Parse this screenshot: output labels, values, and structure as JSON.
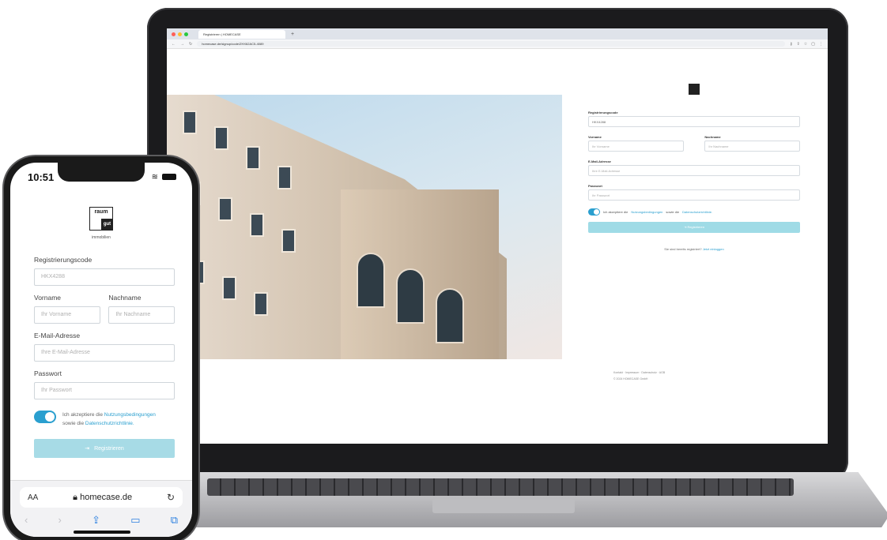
{
  "laptop": {
    "browser": {
      "tab_title": "Registrieren | HOMECASE",
      "url": "homecase.de/signup/code/ZHX62AC5-4089",
      "icons": [
        "back-icon",
        "forward-icon",
        "reload-icon",
        "lock-icon",
        "key-icon",
        "share-icon",
        "star-icon",
        "tabs-icon",
        "menu-icon"
      ]
    },
    "form": {
      "code_label": "Registrierungscode",
      "code_value": "HKX4288",
      "firstname_label": "Vorname",
      "firstname_placeholder": "Ihr Vorname",
      "lastname_label": "Nachname",
      "lastname_placeholder": "Ihr Nachname",
      "email_label": "E-Mail-Adresse",
      "email_placeholder": "Ihre E-Mail-Adresse",
      "password_label": "Passwort",
      "password_placeholder": "Ihr Passwort",
      "terms_prefix": "Ich akzeptiere die",
      "terms_link": "Nutzungsbedingungen",
      "terms_mid": "sowie die",
      "privacy_link": "Datenschutzrichtlinie.",
      "submit_label": "Registrieren",
      "login_text": "Sie sind bereits registriert?",
      "login_link": "Jetzt einloggen"
    },
    "footer": {
      "links": "Kontakt · Impressum · Datenschutz · AGB",
      "copyright": "© 2024 HOMECASE GmbH"
    }
  },
  "phone": {
    "status_time": "10:51",
    "logo": {
      "word1": "raum",
      "word2": "gut",
      "sub": "immobilien"
    },
    "form": {
      "code_label": "Registrierungscode",
      "code_value": "HKX4288",
      "firstname_label": "Vorname",
      "firstname_placeholder": "Ihr Vorname",
      "lastname_label": "Nachname",
      "lastname_placeholder": "Ihr Nachname",
      "email_label": "E-Mail-Adresse",
      "email_placeholder": "Ihre E-Mail-Adresse",
      "password_label": "Passwort",
      "password_placeholder": "Ihr Passwort",
      "terms_prefix": "Ich akzeptiere die",
      "terms_link": "Nutzungsbedingungen",
      "terms_mid": "sowie die",
      "privacy_link": "Datenschutzrichtlinie.",
      "submit_label": "Registrieren"
    },
    "safari": {
      "aa": "AA",
      "domain": "homecase.de"
    }
  },
  "colors": {
    "accent": "#2a9fcf",
    "button_disabled": "#a7dbe6",
    "device_frame": "#1a1a1a"
  }
}
